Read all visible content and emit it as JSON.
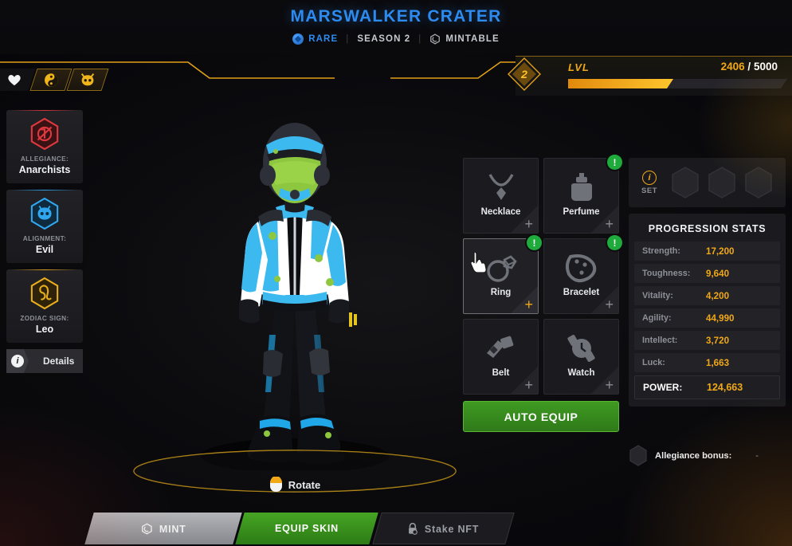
{
  "header": {
    "title": "MARSWALKER CRATER",
    "rarity": "RARE",
    "season": "SEASON 2",
    "mintable": "MINTABLE",
    "separator": "|",
    "rarity_color": "#2d8bf0",
    "title_color": "#2d8bf0"
  },
  "level": {
    "label": "LVL",
    "value": "2",
    "xp_current": "2406",
    "xp_separator": "/",
    "xp_max": "5000",
    "xp_percent": 48,
    "accent_color": "#f0a817"
  },
  "faction_tabs": [
    {
      "icon": "heart-skull-icon",
      "name": "faction-tab-1"
    },
    {
      "icon": "yin-yang-icon",
      "name": "faction-tab-2"
    },
    {
      "icon": "demon-skull-icon",
      "name": "faction-tab-3"
    }
  ],
  "attributes": [
    {
      "label": "ALLEGIANCE:",
      "value": "Anarchists",
      "icon": "anarchy-icon",
      "color": "#d3343a"
    },
    {
      "label": "ALIGNMENT:",
      "value": "Evil",
      "icon": "demon-skull-icon",
      "color": "#2c9fe6"
    },
    {
      "label": "ZODIAC SIGN:",
      "value": "Leo",
      "icon": "leo-zodiac-icon",
      "color": "#e0a91c"
    }
  ],
  "details_button": {
    "label": "Details",
    "icon": "info-icon"
  },
  "stage": {
    "rotate_label": "Rotate",
    "rotate_icon": "mouse-icon"
  },
  "equipment": {
    "slots": [
      {
        "name": "Necklace",
        "icon": "necklace-icon",
        "badge": "",
        "hovered": false
      },
      {
        "name": "Perfume",
        "icon": "perfume-icon",
        "badge": "!",
        "hovered": false
      },
      {
        "name": "Ring",
        "icon": "ring-icon",
        "badge": "!",
        "hovered": true
      },
      {
        "name": "Bracelet",
        "icon": "bracelet-icon",
        "badge": "!",
        "hovered": false
      },
      {
        "name": "Belt",
        "icon": "belt-icon",
        "badge": "",
        "hovered": false
      },
      {
        "name": "Watch",
        "icon": "watch-icon",
        "badge": "",
        "hovered": false
      }
    ],
    "auto_equip_label": "AUTO EQUIP",
    "auto_equip_color": "#3f9a22",
    "badge_color": "#1faa3c"
  },
  "set_panel": {
    "label": "SET",
    "icon": "info-icon",
    "slot_count": 3
  },
  "stats": {
    "title": "PROGRESSION STATS",
    "rows": [
      {
        "label": "Strength:",
        "value": "17,200"
      },
      {
        "label": "Toughness:",
        "value": "9,640"
      },
      {
        "label": "Vitality:",
        "value": "4,200"
      },
      {
        "label": "Agility:",
        "value": "44,990"
      },
      {
        "label": "Intellect:",
        "value": "3,720"
      },
      {
        "label": "Luck:",
        "value": "1,663"
      }
    ],
    "power_label": "POWER:",
    "power_value": "124,663",
    "value_color": "#f0a817"
  },
  "allegiance_bonus": {
    "label": "Allegiance bonus:",
    "value": "-",
    "icon": "hexagon-icon"
  },
  "bottom_tabs": [
    {
      "label": "MINT",
      "icon": "mint-icon",
      "state": "inactive"
    },
    {
      "label": "EQUIP SKIN",
      "icon": "",
      "state": "active"
    },
    {
      "label": "Stake NFT",
      "icon": "lock-icon",
      "state": "disabled"
    }
  ]
}
